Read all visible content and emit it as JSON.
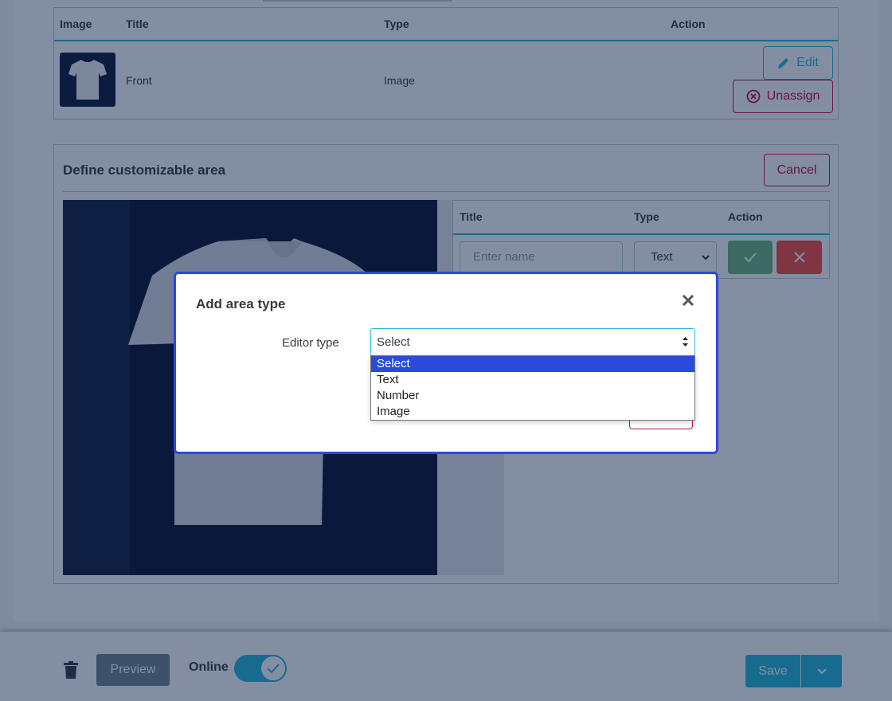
{
  "images_table": {
    "headers": {
      "image": "Image",
      "title": "Title",
      "type": "Type",
      "action": "Action"
    },
    "row": {
      "title": "Front",
      "type": "Image",
      "edit_label": "Edit",
      "unassign_label": "Unassign"
    }
  },
  "area_panel": {
    "title": "Define customizable area",
    "cancel_label": "Cancel",
    "table": {
      "headers": {
        "title": "Title",
        "type": "Type",
        "action": "Action"
      },
      "name_placeholder": "Enter name",
      "type_value": "Text"
    }
  },
  "footer": {
    "preview_label": "Preview",
    "online_label": "Online",
    "online": true,
    "save_label": "Save"
  },
  "modal": {
    "title": "Add area type",
    "field_label": "Editor type",
    "selected": "Select",
    "options": [
      "Select",
      "Text",
      "Number",
      "Image"
    ]
  },
  "colors": {
    "accent": "#25b9d7",
    "danger": "#c90c3a",
    "success": "#70b580",
    "modal_border": "#2e48e0",
    "dropdown_highlight": "#2a4bd8"
  }
}
